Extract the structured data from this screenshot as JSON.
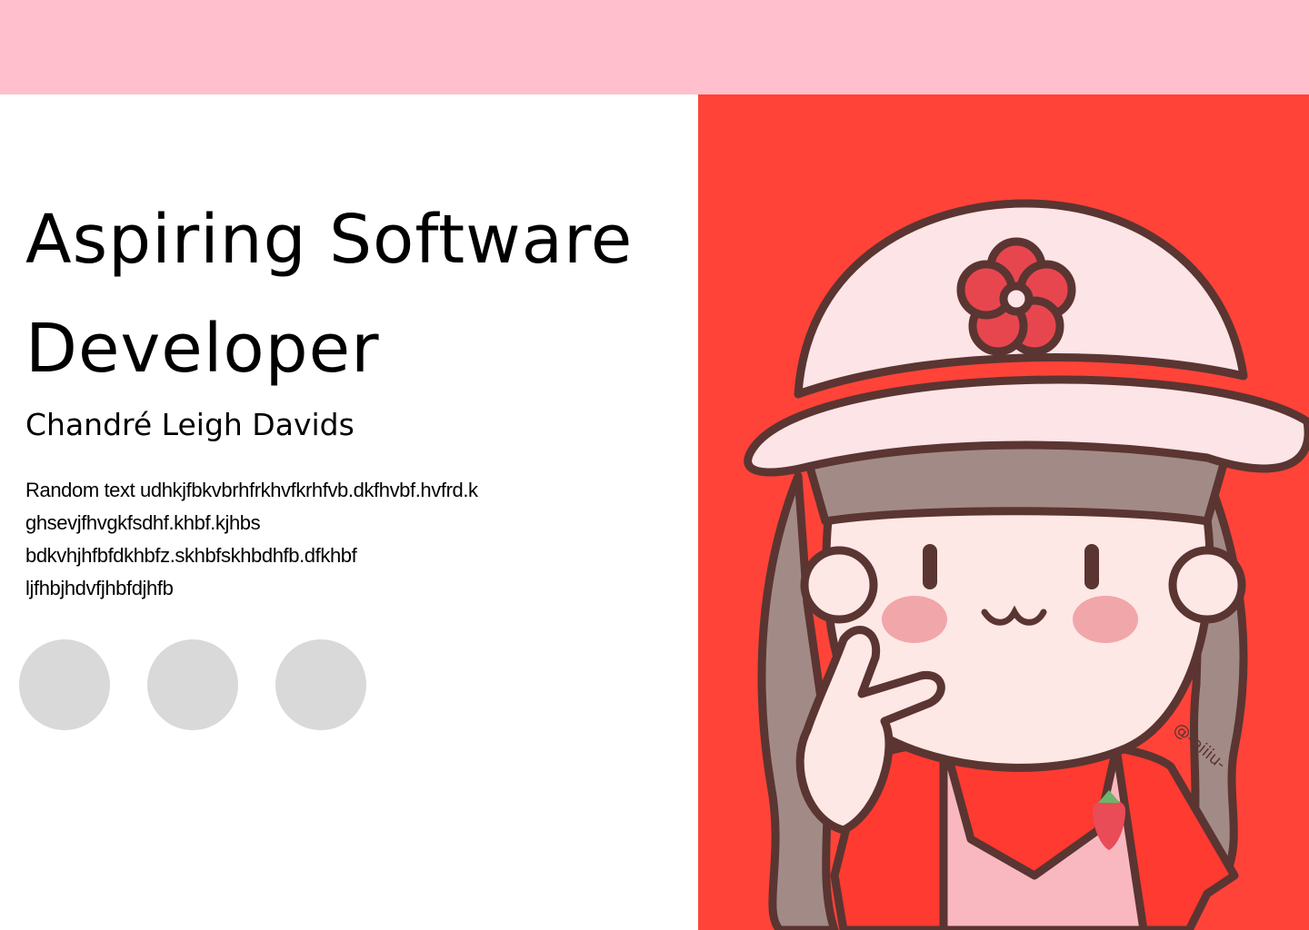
{
  "header": {
    "color": "#ffbfcc"
  },
  "hero": {
    "title_line1": "Aspiring Software",
    "title_line2": "Developer",
    "name": "Chandré Leigh Davids",
    "bio_lines": [
      "Random text udhkjfbkvbrhfrkhvfkrhfvb.dkfhvbf.hvfrd.k",
      "ghsevjfhvgkfsdhf.khbf.kjhbs",
      "bdkvhjhfbfdkhbfz.skhbfskhbdhfb.dfkhbf",
      "ljfhbjhdvfjhbfdjhfb"
    ]
  },
  "social_links": [
    {
      "id": "social-1",
      "color": "#d9d9d9"
    },
    {
      "id": "social-2",
      "color": "#d9d9d9"
    },
    {
      "id": "social-3",
      "color": "#d9d9d9"
    }
  ],
  "illustration": {
    "background": "#ff4338",
    "watermark": "@-eiiiu-"
  }
}
